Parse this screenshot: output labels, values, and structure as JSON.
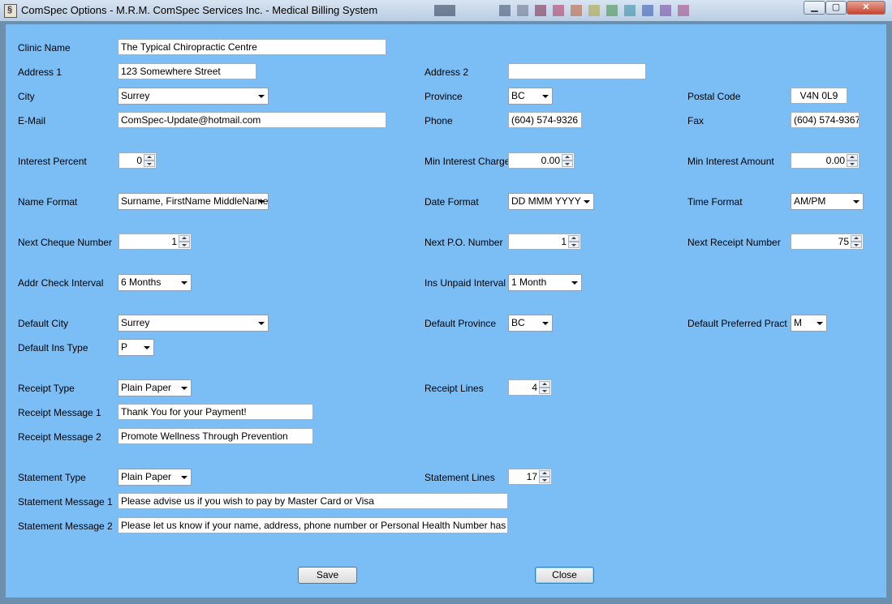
{
  "window": {
    "title": "ComSpec Options - M.R.M. ComSpec Services Inc. - Medical Billing System",
    "controls": {
      "minimize": "▁",
      "maximize": "▢",
      "close": "✕"
    },
    "swatch_colors": [
      "#2a3550",
      "#3a4a6a",
      "#6a7088",
      "#7a2040",
      "#b0305a",
      "#c05a2a",
      "#b0a030",
      "#3a8a40",
      "#2a8aa0",
      "#3050b0",
      "#7040a0",
      "#a04080"
    ]
  },
  "form": {
    "clinic_name": {
      "label": "Clinic Name",
      "value": "The Typical Chiropractic Centre"
    },
    "address1": {
      "label": "Address 1",
      "value": "123 Somewhere Street"
    },
    "address2": {
      "label": "Address 2",
      "value": ""
    },
    "city": {
      "label": "City",
      "value": "Surrey"
    },
    "province": {
      "label": "Province",
      "value": "BC"
    },
    "postal_code": {
      "label": "Postal Code",
      "value": "V4N 0L9"
    },
    "email": {
      "label": "E-Mail",
      "value": "ComSpec-Update@hotmail.com"
    },
    "phone": {
      "label": "Phone",
      "value": "(604) 574-9326"
    },
    "fax": {
      "label": "Fax",
      "value": "(604) 574-9367"
    },
    "interest_percent": {
      "label": "Interest Percent",
      "value": "0"
    },
    "min_interest_charge": {
      "label": "Min Interest Charge",
      "value": "0.00"
    },
    "min_interest_amount": {
      "label": "Min Interest Amount",
      "value": "0.00"
    },
    "name_format": {
      "label": "Name Format",
      "value": "Surname, FirstName MiddleNames"
    },
    "date_format": {
      "label": "Date Format",
      "value": "DD MMM YYYY"
    },
    "time_format": {
      "label": "Time Format",
      "value": "AM/PM"
    },
    "next_cheque_number": {
      "label": "Next Cheque Number",
      "value": "1"
    },
    "next_po_number": {
      "label": "Next P.O. Number",
      "value": "1"
    },
    "next_receipt_number": {
      "label": "Next Receipt Number",
      "value": "75"
    },
    "addr_check_interval": {
      "label": "Addr Check Interval",
      "value": "6 Months"
    },
    "ins_unpaid_interval": {
      "label": "Ins Unpaid Interval",
      "value": "1 Month"
    },
    "default_city": {
      "label": "Default City",
      "value": "Surrey"
    },
    "default_province": {
      "label": "Default Province",
      "value": "BC"
    },
    "default_preferred_pract": {
      "label": "Default Preferred Pract",
      "value": "M"
    },
    "default_ins_type": {
      "label": "Default Ins Type",
      "value": "P"
    },
    "receipt_type": {
      "label": "Receipt Type",
      "value": "Plain Paper"
    },
    "receipt_lines": {
      "label": "Receipt Lines",
      "value": "4"
    },
    "receipt_message1": {
      "label": "Receipt Message 1",
      "value": "Thank You for your Payment!"
    },
    "receipt_message2": {
      "label": "Receipt Message 2",
      "value": "Promote Wellness Through Prevention"
    },
    "statement_type": {
      "label": "Statement Type",
      "value": "Plain Paper"
    },
    "statement_lines": {
      "label": "Statement Lines",
      "value": "17"
    },
    "statement_message1": {
      "label": "Statement Message 1",
      "value": "Please advise us if you wish to pay by Master Card or Visa"
    },
    "statement_message2": {
      "label": "Statement Message 2",
      "value": "Please let us know if your name, address, phone number or Personal Health Number has changed"
    }
  },
  "buttons": {
    "save": "Save",
    "close": "Close"
  }
}
